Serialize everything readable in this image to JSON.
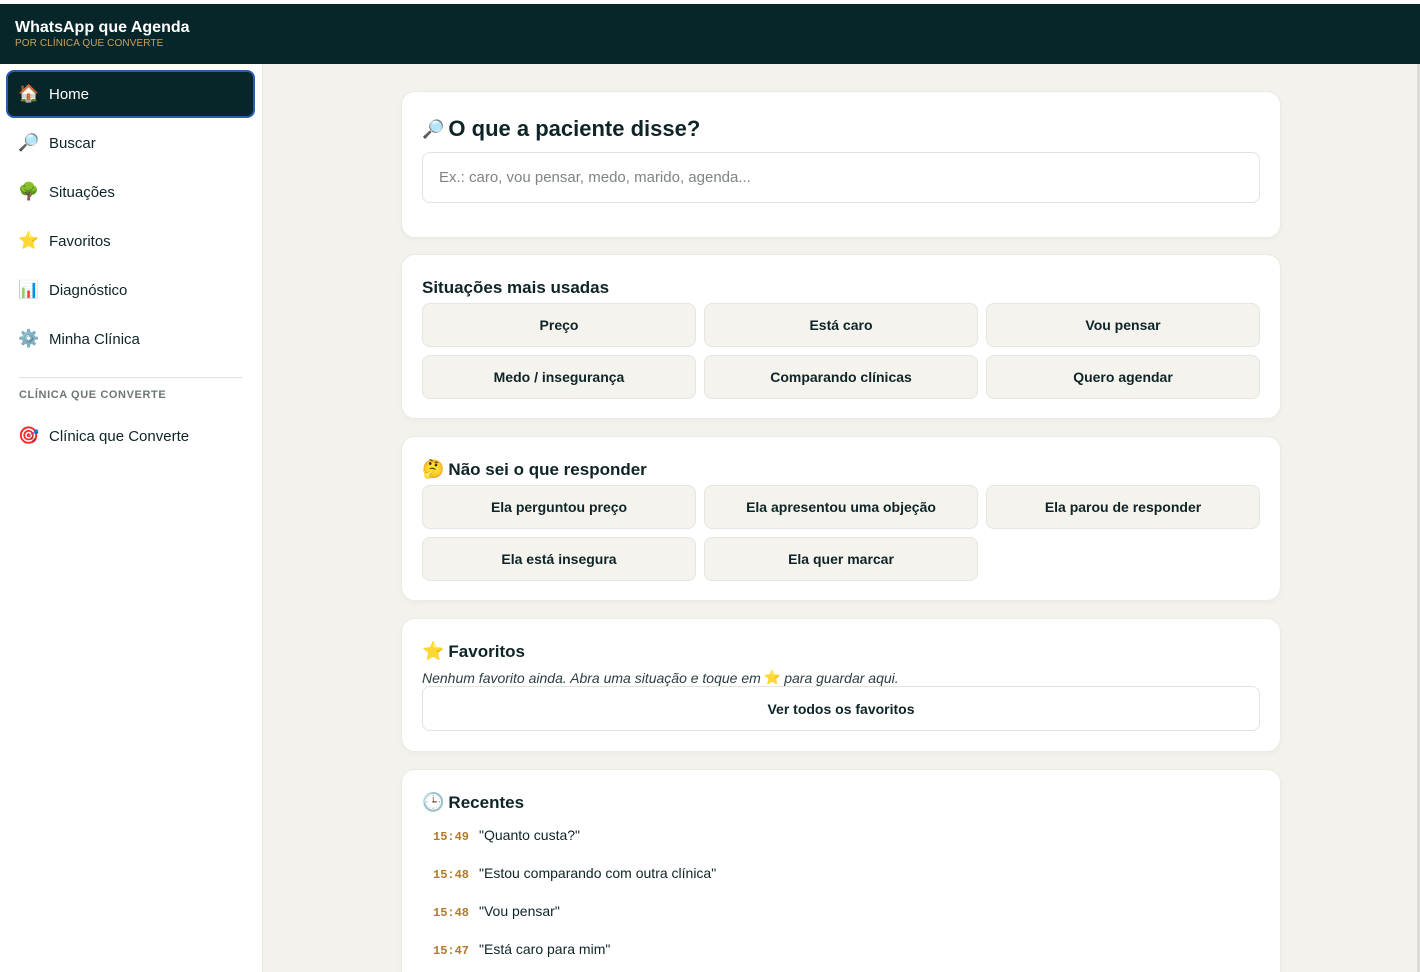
{
  "app": {
    "title": "WhatsApp que Agenda",
    "subtitle": "POR CLÍNICA QUE CONVERTE"
  },
  "sidebar": {
    "items": [
      {
        "label": "Home",
        "icon": "🏠",
        "active": true
      },
      {
        "label": "Buscar",
        "icon": "🔎"
      },
      {
        "label": "Situações",
        "icon": "🌳"
      },
      {
        "label": "Favoritos",
        "icon": "⭐"
      },
      {
        "label": "Diagnóstico",
        "icon": "📊"
      },
      {
        "label": "Minha Clínica",
        "icon": "⚙️"
      }
    ],
    "section_label": "CLÍNICA QUE CONVERTE",
    "section_items": [
      {
        "label": "Clínica que Converte",
        "icon": "🎯"
      }
    ]
  },
  "search": {
    "icon": "🔎",
    "title": "O que a paciente disse?",
    "placeholder": "Ex.: caro, vou pensar, medo, marido, agenda..."
  },
  "situacoes": {
    "title": "Situações mais usadas",
    "buttons": [
      "Preço",
      "Está caro",
      "Vou pensar",
      "Medo / insegurança",
      "Comparando clínicas",
      "Quero agendar"
    ]
  },
  "nao_sei": {
    "icon": "🤔",
    "title": "Não sei o que responder",
    "buttons": [
      "Ela perguntou preço",
      "Ela apresentou uma objeção",
      "Ela parou de responder",
      "Ela está insegura",
      "Ela quer marcar"
    ]
  },
  "favoritos": {
    "icon": "⭐",
    "title": "Favoritos",
    "empty_before": "Nenhum favorito ainda. Abra uma situação e toque em",
    "empty_icon": "⭐",
    "empty_after": "para guardar aqui.",
    "button": "Ver todos os favoritos"
  },
  "recentes": {
    "icon": "🕒",
    "title": "Recentes",
    "items": [
      {
        "time": "15:49",
        "text": "\"Quanto custa?\""
      },
      {
        "time": "15:48",
        "text": "\"Estou comparando com outra clínica\""
      },
      {
        "time": "15:48",
        "text": "\"Vou pensar\""
      },
      {
        "time": "15:47",
        "text": "\"Está caro para mim\""
      }
    ]
  },
  "colors": {
    "topbar": "#07262a",
    "accent_gold": "#c9a15c",
    "active_border": "#2b5cae",
    "background": "#f3f2ed"
  }
}
